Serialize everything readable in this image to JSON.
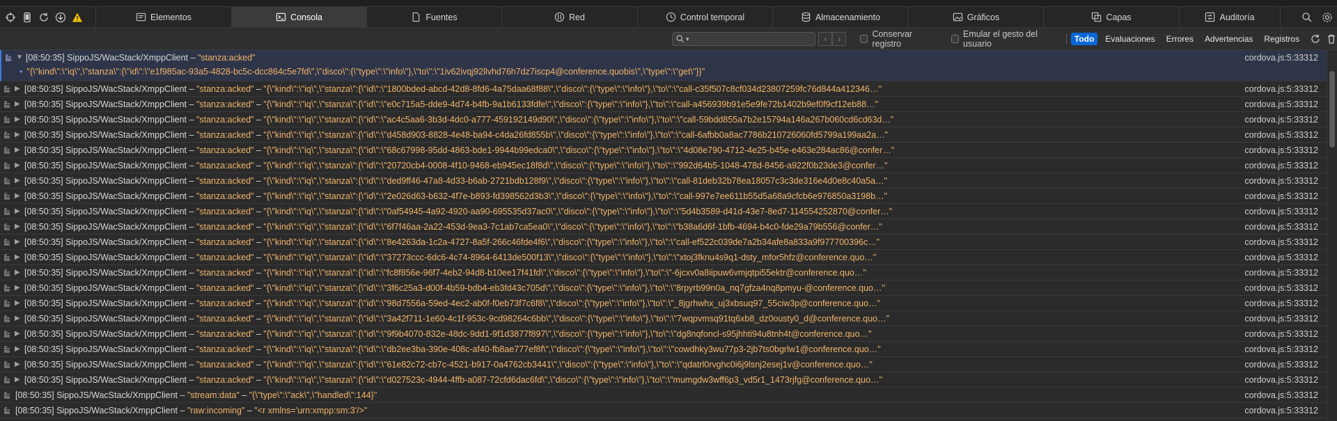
{
  "toolbar": {
    "icons": [
      "crosshair-icon",
      "device-icon",
      "reload-icon",
      "download-icon",
      "warning-icon"
    ]
  },
  "tabs": [
    {
      "label": "Elementos",
      "icon": "elements-icon"
    },
    {
      "label": "Consola",
      "icon": "console-icon",
      "active": true
    },
    {
      "label": "Fuentes",
      "icon": "sources-icon"
    },
    {
      "label": "Red",
      "icon": "network-icon"
    },
    {
      "label": "Control temporal",
      "icon": "timeline-icon"
    },
    {
      "label": "Almacenamiento",
      "icon": "storage-icon"
    },
    {
      "label": "Gráficos",
      "icon": "graphics-icon"
    },
    {
      "label": "Capas",
      "icon": "layers-icon"
    },
    {
      "label": "Auditoría",
      "icon": "audit-icon"
    }
  ],
  "filter": {
    "preserve_log": "Conservar registro",
    "emulate_gesture": "Emular el gesto del usuario",
    "buttons": [
      "Todo",
      "Evaluaciones",
      "Errores",
      "Advertencias",
      "Registros"
    ]
  },
  "colors": {
    "accent": "#0a67d8",
    "string": "#f0b56c",
    "expanded_bg": "#2f3548"
  },
  "expanded": {
    "ts": "[08:50:35]",
    "src": "SippoJS/WacStack/XmppClient",
    "sep": "–",
    "key": "\"stanza:acked\"",
    "detail": "\"{\\\"kind\\\":\\\"iq\\\",\\\"stanza\\\":{\\\"id\\\":\\\"e1f985ac-93a5-4828-bc5c-dcc864c5e7fd\\\",\\\"disco\\\":{\\\"type\\\":\\\"info\\\"},\\\"to\\\":\\\"1iv62ivqj92llvhd76h7dz7iscp4@conference.quobis\\\",\\\"type\\\":\\\"get\\\"}}\"",
    "loc": "cordova.js:5:33312"
  },
  "rows": [
    {
      "ts": "[08:50:35]",
      "src": "SippoJS/WacStack/XmppClient",
      "sep": "–",
      "key": "\"stanza:acked\"",
      "sep2": "–",
      "val": "\"{\\\"kind\\\":\\\"iq\\\",\\\"stanza\\\":{\\\"id\\\":\\\"1800bded-abcd-42d8-8fd6-4a75daa68f88\\\",\\\"disco\\\":{\\\"type\\\":\\\"info\\\"},\\\"to\\\":\\\"call-c35f507c8cf034d23807259fc76d844a412346…\"",
      "loc": "cordova.js:5:33312"
    },
    {
      "ts": "[08:50:35]",
      "src": "SippoJS/WacStack/XmppClient",
      "sep": "–",
      "key": "\"stanza:acked\"",
      "sep2": "–",
      "val": "\"{\\\"kind\\\":\\\"iq\\\",\\\"stanza\\\":{\\\"id\\\":\\\"e0c715a5-dde9-4d74-b4fb-9a1b6133fdfe\\\",\\\"disco\\\":{\\\"type\\\":\\\"info\\\"},\\\"to\\\":\\\"call-a456939b91e5e9fe72b1402b9ef0f9cf12eb88…\"",
      "loc": "cordova.js:5:33312"
    },
    {
      "ts": "[08:50:35]",
      "src": "SippoJS/WacStack/XmppClient",
      "sep": "–",
      "key": "\"stanza:acked\"",
      "sep2": "–",
      "val": "\"{\\\"kind\\\":\\\"iq\\\",\\\"stanza\\\":{\\\"id\\\":\\\"ac4c5aa6-3b3d-4dc0-a777-459192149d90\\\",\\\"disco\\\":{\\\"type\\\":\\\"info\\\"},\\\"to\\\":\\\"call-59bdd855a7b2e15794a146a267b060cd6cd63d…\"",
      "loc": "cordova.js:5:33312"
    },
    {
      "ts": "[08:50:35]",
      "src": "SippoJS/WacStack/XmppClient",
      "sep": "–",
      "key": "\"stanza:acked\"",
      "sep2": "–",
      "val": "\"{\\\"kind\\\":\\\"iq\\\",\\\"stanza\\\":{\\\"id\\\":\\\"d458d903-8828-4e48-ba94-c4da26fd855b\\\",\\\"disco\\\":{\\\"type\\\":\\\"info\\\"},\\\"to\\\":\\\"call-6afbb0a8ac7786b210726060fd5799a199aa2a…\"",
      "loc": "cordova.js:5:33312"
    },
    {
      "ts": "[08:50:35]",
      "src": "SippoJS/WacStack/XmppClient",
      "sep": "–",
      "key": "\"stanza:acked\"",
      "sep2": "–",
      "val": "\"{\\\"kind\\\":\\\"iq\\\",\\\"stanza\\\":{\\\"id\\\":\\\"68c67998-95dd-4863-bde1-9944b99edca0\\\",\\\"disco\\\":{\\\"type\\\":\\\"info\\\"},\\\"to\\\":\\\"4d08e790-4712-4e25-b45e-e463e284ac86@confer…\"",
      "loc": "cordova.js:5:33312"
    },
    {
      "ts": "[08:50:35]",
      "src": "SippoJS/WacStack/XmppClient",
      "sep": "–",
      "key": "\"stanza:acked\"",
      "sep2": "–",
      "val": "\"{\\\"kind\\\":\\\"iq\\\",\\\"stanza\\\":{\\\"id\\\":\\\"20720cb4-0008-4f10-9468-eb945ec18f8d\\\",\\\"disco\\\":{\\\"type\\\":\\\"info\\\"},\\\"to\\\":\\\"992d64b5-1048-478d-8456-a922f0b23de3@confer…\"",
      "loc": "cordova.js:5:33312"
    },
    {
      "ts": "[08:50:35]",
      "src": "SippoJS/WacStack/XmppClient",
      "sep": "–",
      "key": "\"stanza:acked\"",
      "sep2": "–",
      "val": "\"{\\\"kind\\\":\\\"iq\\\",\\\"stanza\\\":{\\\"id\\\":\\\"ded9ff46-47a8-4d33-b6ab-2721bdb128f9\\\",\\\"disco\\\":{\\\"type\\\":\\\"info\\\"},\\\"to\\\":\\\"call-81deb32b78ea18057c3c3de316e4d0e8c40a5a…\"",
      "loc": "cordova.js:5:33312"
    },
    {
      "ts": "[08:50:35]",
      "src": "SippoJS/WacStack/XmppClient",
      "sep": "–",
      "key": "\"stanza:acked\"",
      "sep2": "–",
      "val": "\"{\\\"kind\\\":\\\"iq\\\",\\\"stanza\\\":{\\\"id\\\":\\\"2e026d63-b632-4f7e-b893-fd398562d3b3\\\",\\\"disco\\\":{\\\"type\\\":\\\"info\\\"},\\\"to\\\":\\\"call-997e7ee611b55d5a68a9cfcb6e976850a3198b…\"",
      "loc": "cordova.js:5:33312"
    },
    {
      "ts": "[08:50:35]",
      "src": "SippoJS/WacStack/XmppClient",
      "sep": "–",
      "key": "\"stanza:acked\"",
      "sep2": "–",
      "val": "\"{\\\"kind\\\":\\\"iq\\\",\\\"stanza\\\":{\\\"id\\\":\\\"0af54945-4a92-4920-aa90-695535d37ac0\\\",\\\"disco\\\":{\\\"type\\\":\\\"info\\\"},\\\"to\\\":\\\"5d4b3589-d41d-43e7-8ed7-114554252870@confer…\"",
      "loc": "cordova.js:5:33312"
    },
    {
      "ts": "[08:50:35]",
      "src": "SippoJS/WacStack/XmppClient",
      "sep": "–",
      "key": "\"stanza:acked\"",
      "sep2": "–",
      "val": "\"{\\\"kind\\\":\\\"iq\\\",\\\"stanza\\\":{\\\"id\\\":\\\"6f7f46aa-2a22-453d-9ea3-7c1ab7ca5ea0\\\",\\\"disco\\\":{\\\"type\\\":\\\"info\\\"},\\\"to\\\":\\\"b38a6d6f-1bfb-4694-b4c0-fde29a79b556@confer…\"",
      "loc": "cordova.js:5:33312"
    },
    {
      "ts": "[08:50:35]",
      "src": "SippoJS/WacStack/XmppClient",
      "sep": "–",
      "key": "\"stanza:acked\"",
      "sep2": "–",
      "val": "\"{\\\"kind\\\":\\\"iq\\\",\\\"stanza\\\":{\\\"id\\\":\\\"8e4263da-1c2a-4727-8a5f-266c46fde4f6\\\",\\\"disco\\\":{\\\"type\\\":\\\"info\\\"},\\\"to\\\":\\\"call-ef522c039de7a2b34afe8a833a9f977700396c…\"",
      "loc": "cordova.js:5:33312"
    },
    {
      "ts": "[08:50:35]",
      "src": "SippoJS/WacStack/XmppClient",
      "sep": "–",
      "key": "\"stanza:acked\"",
      "sep2": "–",
      "val": "\"{\\\"kind\\\":\\\"iq\\\",\\\"stanza\\\":{\\\"id\\\":\\\"37273ccc-6dc6-4c74-8964-6413de500f13\\\",\\\"disco\\\":{\\\"type\\\":\\\"info\\\"},\\\"to\\\":\\\"xtoj3fknu4s9q1-dsty_mfor5hfz@conference.quo…\"",
      "loc": "cordova.js:5:33312"
    },
    {
      "ts": "[08:50:35]",
      "src": "SippoJS/WacStack/XmppClient",
      "sep": "–",
      "key": "\"stanza:acked\"",
      "sep2": "–",
      "val": "\"{\\\"kind\\\":\\\"iq\\\",\\\"stanza\\\":{\\\"id\\\":\\\"fc8f856e-96f7-4eb2-94d8-b10ee17f41fd\\\",\\\"disco\\\":{\\\"type\\\":\\\"info\\\"},\\\"to\\\":\\\"-6jcxv0a8iipuw6vmjqtpi55ektr@conference.quo…\"",
      "loc": "cordova.js:5:33312"
    },
    {
      "ts": "[08:50:35]",
      "src": "SippoJS/WacStack/XmppClient",
      "sep": "–",
      "key": "\"stanza:acked\"",
      "sep2": "–",
      "val": "\"{\\\"kind\\\":\\\"iq\\\",\\\"stanza\\\":{\\\"id\\\":\\\"3f6c25a3-d00f-4b59-bdb4-eb3fd43c705d\\\",\\\"disco\\\":{\\\"type\\\":\\\"info\\\"},\\\"to\\\":\\\"8rpyrb99n0a_nq7gfza4nq8pmyu-@conference.quo…\"",
      "loc": "cordova.js:5:33312"
    },
    {
      "ts": "[08:50:35]",
      "src": "SippoJS/WacStack/XmppClient",
      "sep": "–",
      "key": "\"stanza:acked\"",
      "sep2": "–",
      "val": "\"{\\\"kind\\\":\\\"iq\\\",\\\"stanza\\\":{\\\"id\\\":\\\"98d7556a-59ed-4ec2-ab0f-f0eb73f7c6f8\\\",\\\"disco\\\":{\\\"type\\\":\\\"info\\\"},\\\"to\\\":\\\"_8jgrhwhx_uj3xbsuq97_55ciw3p@conference.quo…\"",
      "loc": "cordova.js:5:33312"
    },
    {
      "ts": "[08:50:35]",
      "src": "SippoJS/WacStack/XmppClient",
      "sep": "–",
      "key": "\"stanza:acked\"",
      "sep2": "–",
      "val": "\"{\\\"kind\\\":\\\"iq\\\",\\\"stanza\\\":{\\\"id\\\":\\\"3a42f711-1e60-4c1f-953c-9cd98264c6bb\\\",\\\"disco\\\":{\\\"type\\\":\\\"info\\\"},\\\"to\\\":\\\"7wqpvmsq91tq6xb8_dz0ousty0_d@conference.quo…\"",
      "loc": "cordova.js:5:33312"
    },
    {
      "ts": "[08:50:35]",
      "src": "SippoJS/WacStack/XmppClient",
      "sep": "–",
      "key": "\"stanza:acked\"",
      "sep2": "–",
      "val": "\"{\\\"kind\\\":\\\"iq\\\",\\\"stanza\\\":{\\\"id\\\":\\\"9f9b4070-832e-48dc-9dd1-9f1d3877f897\\\",\\\"disco\\\":{\\\"type\\\":\\\"info\\\"},\\\"to\\\":\\\"dg8nqfoncl-s95jhhti94u8tnh4t@conference.quo…\"",
      "loc": "cordova.js:5:33312"
    },
    {
      "ts": "[08:50:35]",
      "src": "SippoJS/WacStack/XmppClient",
      "sep": "–",
      "key": "\"stanza:acked\"",
      "sep2": "–",
      "val": "\"{\\\"kind\\\":\\\"iq\\\",\\\"stanza\\\":{\\\"id\\\":\\\"db2ee3ba-390e-408c-af40-fb8ae777ef8f\\\",\\\"disco\\\":{\\\"type\\\":\\\"info\\\"},\\\"to\\\":\\\"cowdhky3wu77p3-2jb7ts0bgrlw1@conference.quo…\"",
      "loc": "cordova.js:5:33312"
    },
    {
      "ts": "[08:50:35]",
      "src": "SippoJS/WacStack/XmppClient",
      "sep": "–",
      "key": "\"stanza:acked\"",
      "sep2": "–",
      "val": "\"{\\\"kind\\\":\\\"iq\\\",\\\"stanza\\\":{\\\"id\\\":\\\"61e82c72-cb7c-4521-b917-0a4762cb3441\\\",\\\"disco\\\":{\\\"type\\\":\\\"info\\\"},\\\"to\\\":\\\"qdatrl0rvghc0i6j9lsnj2esej1v@conference.quo…\"",
      "loc": "cordova.js:5:33312"
    },
    {
      "ts": "[08:50:35]",
      "src": "SippoJS/WacStack/XmppClient",
      "sep": "–",
      "key": "\"stanza:acked\"",
      "sep2": "–",
      "val": "\"{\\\"kind\\\":\\\"iq\\\",\\\"stanza\\\":{\\\"id\\\":\\\"d027523c-4944-4ffb-a087-72cfd6dac6fd\\\",\\\"disco\\\":{\\\"type\\\":\\\"info\\\"},\\\"to\\\":\\\"mumgdw3wff6p3_vd5r1_1473rjfg@conference.quo…\"",
      "loc": "cordova.js:5:33312"
    }
  ],
  "tail_rows": [
    {
      "ts": "[08:50:35]",
      "src": "SippoJS/WacStack/XmppClient",
      "sep": "–",
      "key": "\"stream:data\"",
      "sep2": "–",
      "val": "\"{\\\"type\\\":\\\"ack\\\",\\\"handled\\\":144}\"",
      "loc": "cordova.js:5:33312"
    },
    {
      "ts": "[08:50:35]",
      "src": "SippoJS/WacStack/XmppClient",
      "sep": "–",
      "key": "\"raw:incoming\"",
      "sep2": "–",
      "val": "\"<r xmlns='urn:xmpp:sm:3'/>\"",
      "loc": "cordova.js:5:33312"
    }
  ]
}
